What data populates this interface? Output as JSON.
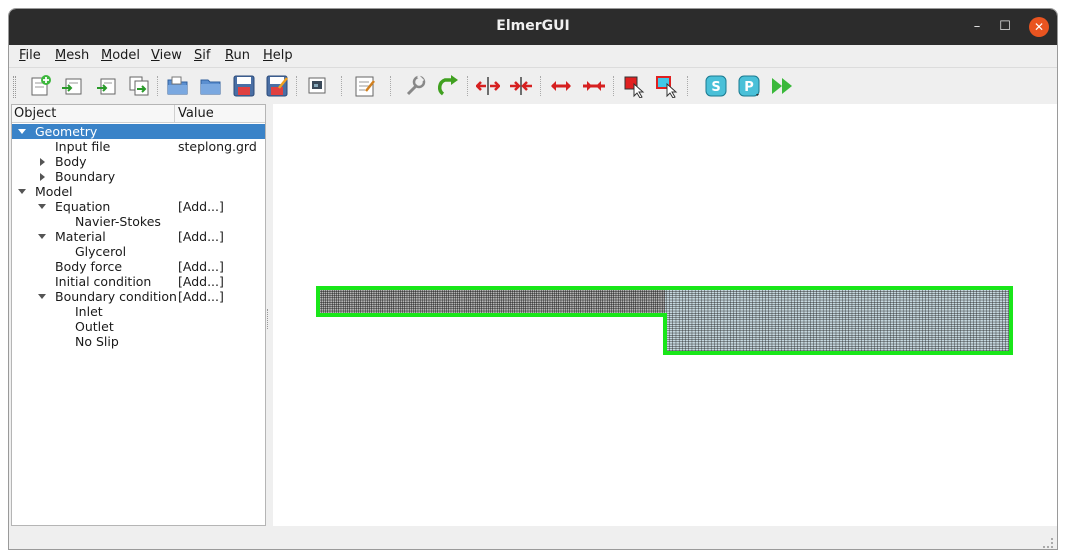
{
  "window": {
    "title": "ElmerGUI"
  },
  "window_controls": {
    "minimize": "–",
    "maximize": "☐",
    "close": "✕"
  },
  "menu": [
    {
      "first": "F",
      "rest": "ile"
    },
    {
      "first": "M",
      "rest": "esh"
    },
    {
      "first": "M",
      "rest": "odel"
    },
    {
      "first": "V",
      "rest": "iew"
    },
    {
      "first": "S",
      "rest": "if"
    },
    {
      "first": "R",
      "rest": "un"
    },
    {
      "first": "H",
      "rest": "elp"
    }
  ],
  "toolbar_icons": [
    "new-icon",
    "open-import-icon",
    "load-icon",
    "load-multiple-icon",
    "open-folder-icon",
    "folder-icon",
    "save-icon",
    "save-as-icon",
    "picture-icon",
    "edit-sif-icon",
    "wrench-icon",
    "redo-icon",
    "divide-surface-icon",
    "unify-surface-icon",
    "divide-edge-icon",
    "unify-edge-icon",
    "select-surface-icon",
    "select-edge-icon",
    "solver-icon",
    "post-icon",
    "run-icon"
  ],
  "tree": {
    "headers": {
      "object": "Object",
      "value": "Value"
    },
    "rows": [
      {
        "label": "Geometry",
        "value": "",
        "level": 0,
        "arrow": "down",
        "selected": true
      },
      {
        "label": "Input file",
        "value": "steplong.grd",
        "level": 1,
        "arrow": "",
        "selected": false
      },
      {
        "label": "Body",
        "value": "",
        "level": 1,
        "arrow": "right",
        "selected": false
      },
      {
        "label": "Boundary",
        "value": "",
        "level": 1,
        "arrow": "right",
        "selected": false
      },
      {
        "label": "Model",
        "value": "",
        "level": 0,
        "arrow": "down",
        "selected": false
      },
      {
        "label": "Equation",
        "value": "[Add...]",
        "level": 1,
        "arrow": "down",
        "selected": false
      },
      {
        "label": "Navier-Stokes",
        "value": "",
        "level": 2,
        "arrow": "",
        "selected": false
      },
      {
        "label": "Material",
        "value": "[Add...]",
        "level": 1,
        "arrow": "down",
        "selected": false
      },
      {
        "label": "Glycerol",
        "value": "",
        "level": 2,
        "arrow": "",
        "selected": false
      },
      {
        "label": "Body force",
        "value": "[Add...]",
        "level": 1,
        "arrow": "",
        "selected": false
      },
      {
        "label": "Initial condition",
        "value": "[Add...]",
        "level": 1,
        "arrow": "",
        "selected": false
      },
      {
        "label": "Boundary condition",
        "value": "[Add...]",
        "level": 1,
        "arrow": "down",
        "selected": false
      },
      {
        "label": "Inlet",
        "value": "",
        "level": 2,
        "arrow": "",
        "selected": false
      },
      {
        "label": "Outlet",
        "value": "",
        "level": 2,
        "arrow": "",
        "selected": false
      },
      {
        "label": "No Slip",
        "value": "",
        "level": 2,
        "arrow": "",
        "selected": false
      }
    ]
  },
  "colors": {
    "selection": "#3a83c8",
    "boundary": "#19e619",
    "mesh": "#111111",
    "close_button": "#e95420"
  }
}
